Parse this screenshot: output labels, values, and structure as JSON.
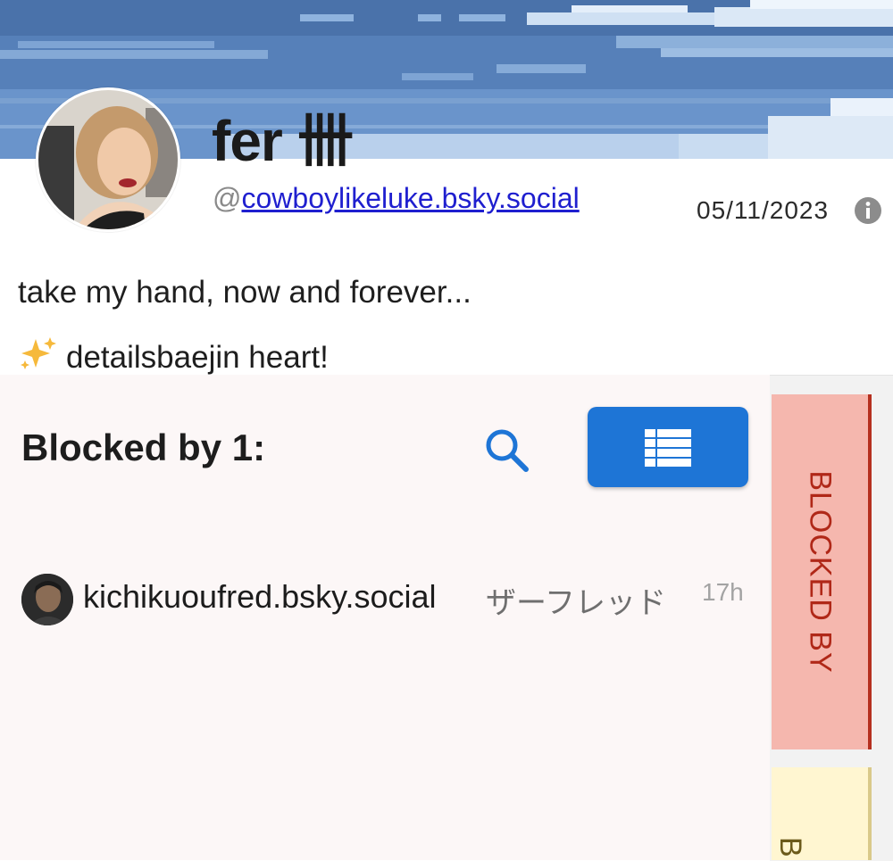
{
  "profile": {
    "display_name": "fer 卌",
    "handle_prefix": "@",
    "handle": "cowboylikeluke.bsky.social",
    "joined": "05/11/2023",
    "bio_line_1": "take my hand, now and forever...",
    "bio_line_2": "detailsbaejin heart!",
    "bio_emoji_icon": "sparkles-icon",
    "info_icon": "info-icon"
  },
  "panel": {
    "title": "Blocked by 1:",
    "search_icon": "search-icon",
    "list_icon": "list-icon",
    "accent_color": "#1e75d6",
    "entries": [
      {
        "handle": "kichikuoufred.bsky.social",
        "display_name": "ザーフレッド",
        "time": "17h"
      }
    ]
  },
  "side_tabs": [
    {
      "label": "BLOCKED BY",
      "color": "#f5b7ae",
      "text_color": "#b02818",
      "active": true
    },
    {
      "label": "B",
      "color": "#fff6d1",
      "text_color": "#6b5a1a",
      "active": false
    }
  ]
}
